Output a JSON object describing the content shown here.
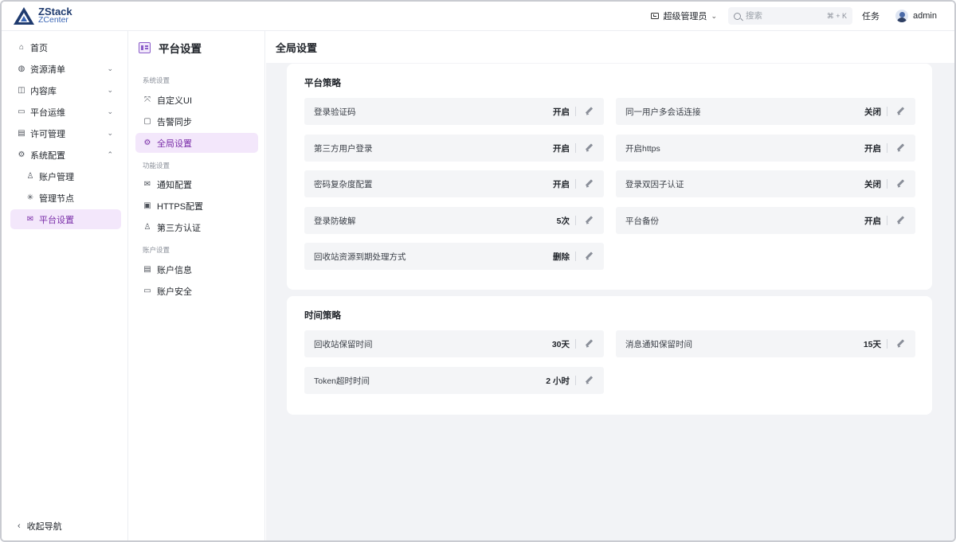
{
  "app": {
    "brand_line1": "ZStack",
    "brand_line2": "ZCenter",
    "role": "超级管理员",
    "search_placeholder": "搜索",
    "search_shortcut": "⌘ + K",
    "tasks": "任务",
    "user": "admin",
    "accent_color": "#7a2ea8"
  },
  "nav": {
    "items": [
      {
        "label": "首页",
        "icon": "home-icon"
      },
      {
        "label": "资源清单",
        "icon": "globe-icon"
      },
      {
        "label": "内容库",
        "icon": "library-icon"
      },
      {
        "label": "平台运维",
        "icon": "ops-icon"
      },
      {
        "label": "许可管理",
        "icon": "license-icon"
      },
      {
        "label": "系统配置",
        "icon": "gear-icon"
      },
      {
        "label": "账户管理",
        "icon": "user-icon"
      },
      {
        "label": "管理节点",
        "icon": "node-icon"
      },
      {
        "label": "平台设置",
        "icon": "mail-icon"
      }
    ],
    "collapse_label": "收起导航"
  },
  "side_panel": {
    "title": "平台设置",
    "groups": [
      "系统设置",
      "功能设置",
      "账户设置"
    ],
    "items": [
      {
        "label": "自定义UI",
        "icon": "customize-icon"
      },
      {
        "label": "告警同步",
        "icon": "alarm-icon"
      },
      {
        "label": "全局设置",
        "icon": "gear-icon"
      },
      {
        "label": "通知配置",
        "icon": "mail-icon"
      },
      {
        "label": "HTTPS配置",
        "icon": "certificate-icon"
      },
      {
        "label": "第三方认证",
        "icon": "user-icon"
      },
      {
        "label": "账户信息",
        "icon": "account-info-icon"
      },
      {
        "label": "账户安全",
        "icon": "security-icon"
      }
    ]
  },
  "main": {
    "title": "全局设置",
    "platform_policy": {
      "title": "平台策略",
      "settings": [
        {
          "label": "登录验证码",
          "value": "开启"
        },
        {
          "label": "同一用户多会话连接",
          "value": "关闭"
        },
        {
          "label": "第三方用户登录",
          "value": "开启"
        },
        {
          "label": "开启https",
          "value": "开启"
        },
        {
          "label": "密码复杂度配置",
          "value": "开启"
        },
        {
          "label": "登录双因子认证",
          "value": "关闭"
        },
        {
          "label": "登录防破解",
          "value": "5次"
        },
        {
          "label": "平台备份",
          "value": "开启"
        },
        {
          "label": "回收站资源到期处理方式",
          "value": "删除"
        }
      ]
    },
    "time_policy": {
      "title": "时间策略",
      "settings": [
        {
          "label": "回收站保留时间",
          "value": "30天"
        },
        {
          "label": "消息通知保留时间",
          "value": "15天"
        },
        {
          "label": "Token超时时间",
          "value": "2 小时"
        }
      ]
    }
  }
}
